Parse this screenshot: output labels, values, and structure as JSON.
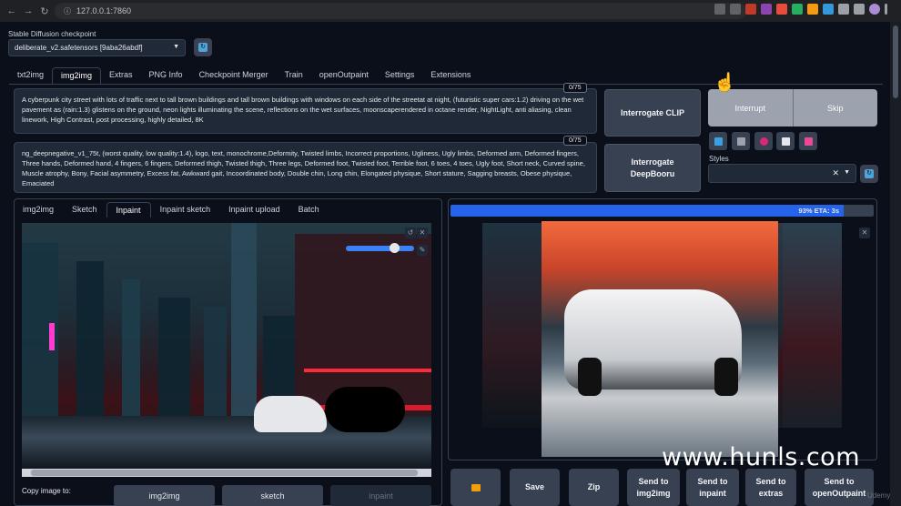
{
  "browser": {
    "url": "127.0.0.1:7860",
    "back_icon": "arrow-left",
    "forward_icon": "arrow-right",
    "reload_icon": "reload"
  },
  "checkpoint": {
    "label": "Stable Diffusion checkpoint",
    "value": "deliberate_v2.safetensors [9aba26abdf]"
  },
  "main_tabs": [
    "txt2img",
    "img2img",
    "Extras",
    "PNG Info",
    "Checkpoint Merger",
    "Train",
    "openOutpaint",
    "Settings",
    "Extensions"
  ],
  "active_main_tab": "img2img",
  "prompt": {
    "text": "A cyberpunk city street with lots of traffic next to tall brown buildings and tall brown buildings with windows on each side of the streetat at night, (futuristic super cars:1.2) driving on the wet pavement as (rain:1.3) glistens on the ground, neon lights illuminating the scene, reflections on the wet surfaces, moonscaperendered in octane render, NightLight, anti aliasing, clean linework, High Contrast, post processing, highly detailed, 8K",
    "token_count": "0/75"
  },
  "negative_prompt": {
    "text": "ng_deepnegative_v1_75t, (worst quality, low quality:1.4), logo, text, monochrome,Deformity, Twisted limbs, Incorrect proportions, Ugliness, Ugly limbs, Deformed arm, Deformed fingers, Three hands, Deformed hand, 4 fingers, 6 fingers, Deformed thigh, Twisted thigh, Three legs, Deformed foot, Twisted foot, Terrible foot, 6 toes, 4 toes, Ugly foot, Short neck, Curved spine, Muscle atrophy, Bony, Facial asymmetry, Excess fat, Awkward gait, Incoordinated body, Double chin, Long chin, Elongated physique, Short stature, Sagging breasts, Obese physique, Emaciated",
    "token_count": "0/75"
  },
  "buttons": {
    "interrogate_clip": "Interrogate CLIP",
    "interrogate_deepbooru_line1": "Interrogate",
    "interrogate_deepbooru_line2": "DeepBooru",
    "interrupt": "Interrupt",
    "skip": "Skip"
  },
  "styles": {
    "label": "Styles",
    "value": ""
  },
  "sub_tabs": [
    "img2img",
    "Sketch",
    "Inpaint",
    "Inpaint sketch",
    "Inpaint upload",
    "Batch"
  ],
  "active_sub_tab": "Inpaint",
  "progress": {
    "fraction": 0.93,
    "text": "93% ETA: 3s"
  },
  "copy_image": {
    "label": "Copy image to:",
    "buttons": [
      "img2img",
      "sketch",
      "inpaint"
    ]
  },
  "output_buttons": [
    {
      "line1": "",
      "line2": "",
      "icon": "folder-icon"
    },
    {
      "line1": "Save",
      "line2": ""
    },
    {
      "line1": "Zip",
      "line2": ""
    },
    {
      "line1": "Send to",
      "line2": "img2img"
    },
    {
      "line1": "Send to",
      "line2": "inpaint"
    },
    {
      "line1": "Send to",
      "line2": "extras"
    },
    {
      "line1": "Send to",
      "line2": "openOutpaint"
    }
  ],
  "watermark": "www.hunls.com",
  "udemy": "Udemy",
  "colors": {
    "background": "#0b0f19",
    "accent": "#2563eb",
    "neon_red": "#ff2b3a"
  }
}
